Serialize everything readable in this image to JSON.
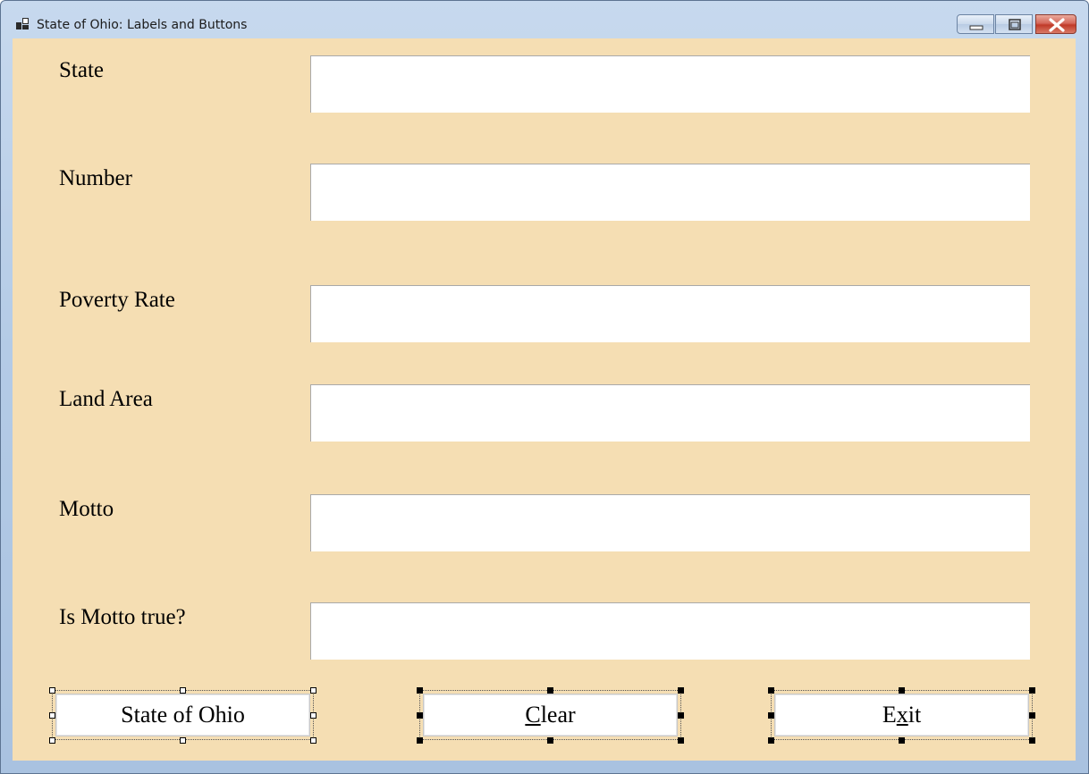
{
  "window": {
    "title": "State of Ohio: Labels and Buttons",
    "controls": {
      "minimize_icon": "minimize-icon",
      "maximize_icon": "maximize-icon",
      "close_icon": "close-icon"
    }
  },
  "form": {
    "background_color": "#f5deb3",
    "fields": [
      {
        "label": "State",
        "value": ""
      },
      {
        "label": "Number",
        "value": ""
      },
      {
        "label": "Poverty Rate",
        "value": ""
      },
      {
        "label": "Land Area",
        "value": ""
      },
      {
        "label": "Motto",
        "value": ""
      },
      {
        "label": "Is Motto true?",
        "value": ""
      }
    ],
    "buttons": {
      "state_of_ohio": "State of Ohio",
      "clear": {
        "pre": "",
        "mnemonic": "C",
        "post": "lear"
      },
      "exit": {
        "pre": "E",
        "mnemonic": "x",
        "post": "it"
      }
    }
  }
}
